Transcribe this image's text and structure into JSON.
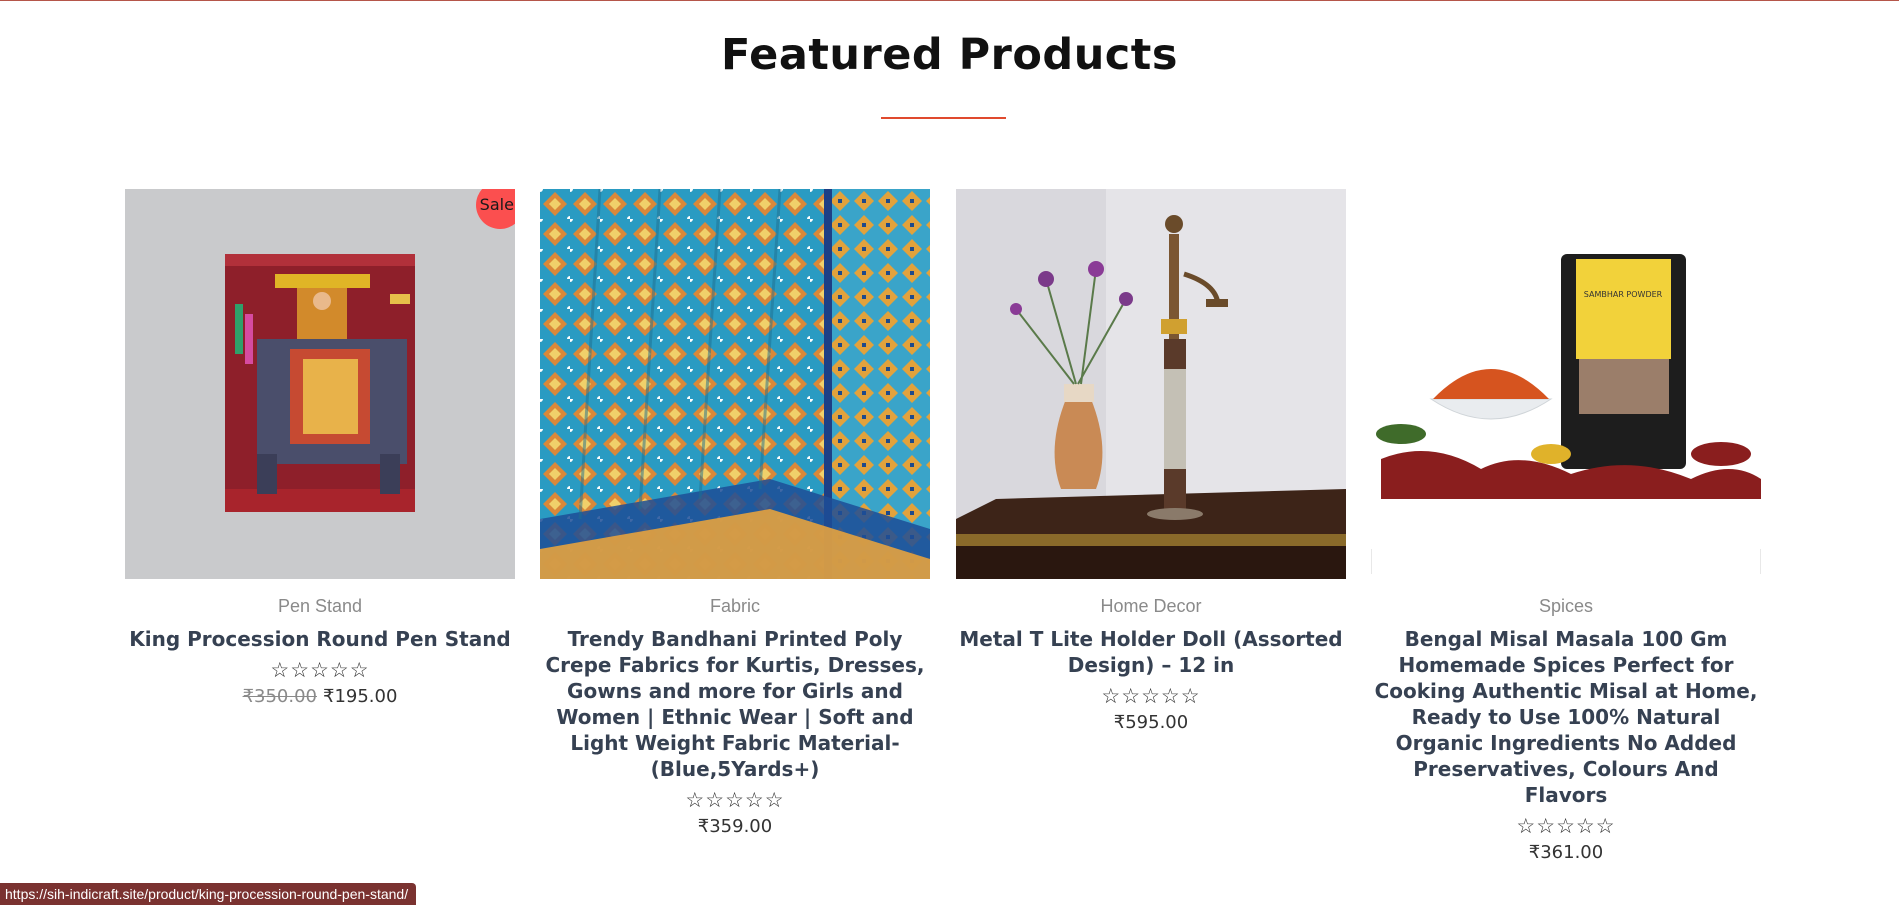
{
  "section": {
    "title": "Featured Products"
  },
  "products": [
    {
      "category": "Pen Stand",
      "title": "King Procession Round Pen Stand",
      "badge": "Sale!",
      "old_price": "₹350.00",
      "price": "₹195.00",
      "stars": "☆☆☆☆☆",
      "image_icon": "pen-stand-image"
    },
    {
      "category": "Fabric",
      "title": "Trendy Bandhani Printed Poly Crepe Fabrics for Kurtis, Dresses, Gowns and more for Girls and Women | Ethnic Wear | Soft and Light Weight Fabric Material-(Blue,5Yards+)",
      "price": "₹359.00",
      "stars": "☆☆☆☆☆",
      "image_icon": "fabric-image"
    },
    {
      "category": "Home Decor",
      "title": "Metal T Lite Holder Doll (Assorted Design) – 12 in",
      "price": "₹595.00",
      "stars": "☆☆☆☆☆",
      "image_icon": "tlite-holder-image"
    },
    {
      "category": "Spices",
      "title": "Bengal Misal Masala 100 Gm Homemade Spices Perfect for Cooking Authentic Misal at Home, Ready to Use 100% Natural Organic Ingredients No Added Preservatives, Colours And Flavors",
      "price": "₹361.00",
      "stars": "☆☆☆☆☆",
      "image_icon": "spices-image",
      "pack_label": "SAMBHAR POWDER"
    }
  ],
  "status_bar": {
    "url": "https://sih-indicraft.site/product/king-procession-round-pen-stand/"
  },
  "colors": {
    "accent": "#e04a2e",
    "sale_badge": "#fb4f4f",
    "title_text": "#364152",
    "status_bar_bg": "#7a3230"
  }
}
